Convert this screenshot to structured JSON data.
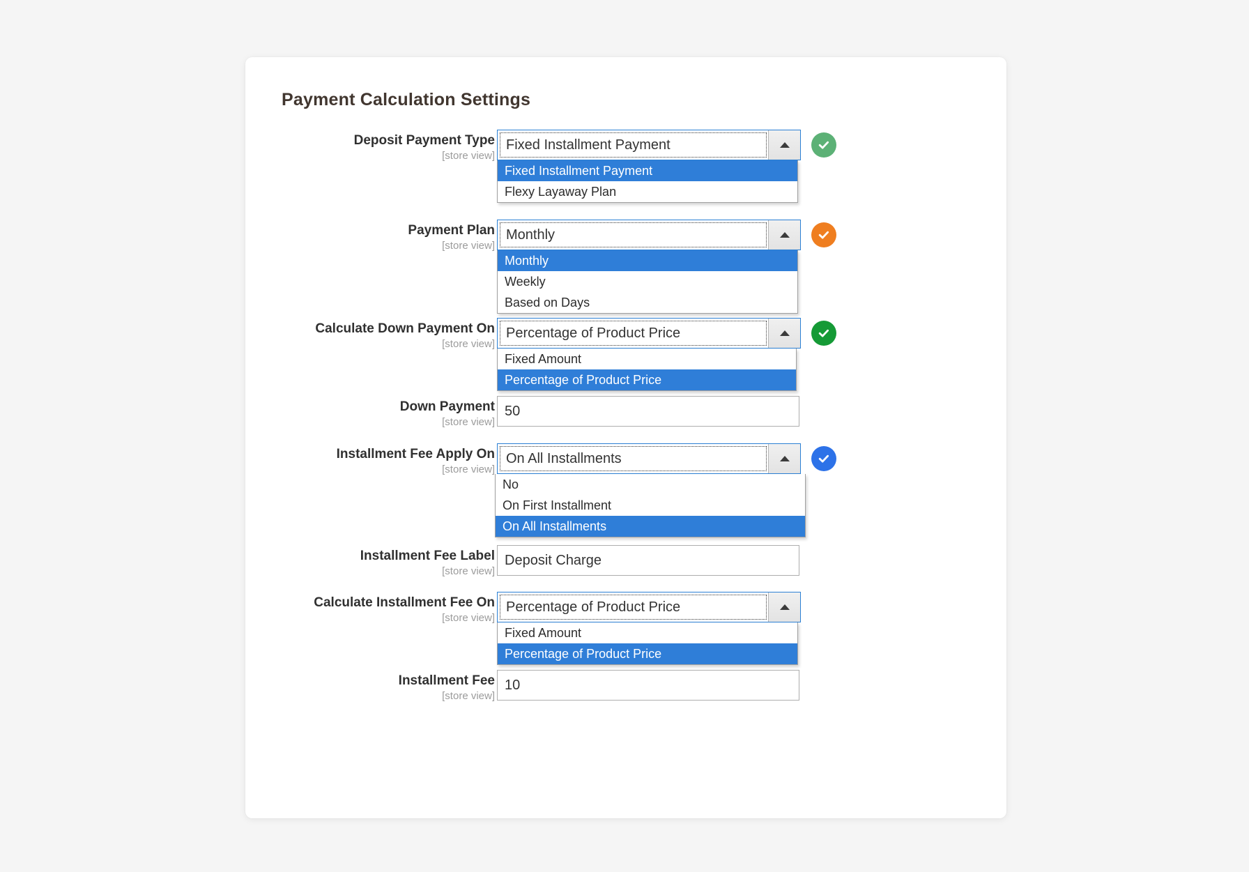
{
  "panel": {
    "title": "Payment Calculation Settings"
  },
  "scope_label": "[store view]",
  "icons": {
    "caret_up": "caret-up-icon",
    "check": "check-icon"
  },
  "colors": {
    "page_bg": "#f5f5f5",
    "panel_bg": "#ffffff",
    "title": "#41362f",
    "label": "#303030",
    "scope": "#9b9b9b",
    "select_border": "#2a7fd4",
    "option_selected_bg": "#2f7ed8",
    "badge_green_light": "#5cb176",
    "badge_green_dark": "#159a36",
    "badge_orange": "#ef7e20",
    "badge_blue": "#2d72e8"
  },
  "fields": [
    {
      "id": "deposit-payment-type",
      "label": "Deposit Payment Type",
      "scope": "[store view]",
      "type": "select",
      "value": "Fixed Installment Payment",
      "options": [
        {
          "label": "Fixed Installment Payment",
          "selected": true
        },
        {
          "label": "Flexy Layaway Plan",
          "selected": false
        }
      ],
      "status": {
        "name": "status-check-green",
        "color": "#5cb176",
        "glyph": "check"
      }
    },
    {
      "id": "payment-plan",
      "label": "Payment Plan",
      "scope": "[store view]",
      "type": "select",
      "value": "Monthly",
      "options": [
        {
          "label": "Monthly",
          "selected": true
        },
        {
          "label": "Weekly",
          "selected": false
        },
        {
          "label": "Based on Days",
          "selected": false
        }
      ],
      "status": {
        "name": "status-check-orange",
        "color": "#ef7e20",
        "glyph": "check"
      }
    },
    {
      "id": "calculate-down-payment-on",
      "label": "Calculate Down Payment On",
      "scope": "[store view]",
      "type": "select",
      "value": "Percentage of Product Price",
      "options": [
        {
          "label": "Fixed Amount",
          "selected": false
        },
        {
          "label": "Percentage of Product Price",
          "selected": true
        }
      ],
      "status": {
        "name": "status-check-green-dark",
        "color": "#159a36",
        "glyph": "check"
      }
    },
    {
      "id": "down-payment",
      "label": "Down Payment",
      "scope": "[store view]",
      "type": "text",
      "value": "50",
      "status": null
    },
    {
      "id": "installment-fee-apply-on",
      "label": "Installment Fee Apply On",
      "scope": "[store view]",
      "type": "select",
      "value": "On All Installments",
      "options": [
        {
          "label": "No",
          "selected": false
        },
        {
          "label": "On First Installment",
          "selected": false
        },
        {
          "label": "On All Installments",
          "selected": true
        }
      ],
      "status": {
        "name": "status-check-blue",
        "color": "#2d72e8",
        "glyph": "check"
      }
    },
    {
      "id": "installment-fee-label",
      "label": "Installment Fee Label",
      "scope": "[store view]",
      "type": "text",
      "value": "Deposit Charge",
      "status": null
    },
    {
      "id": "calculate-installment-fee-on",
      "label": "Calculate Installment Fee On",
      "scope": "[store view]",
      "type": "select",
      "value": "Percentage of Product Price",
      "options": [
        {
          "label": "Fixed Amount",
          "selected": false
        },
        {
          "label": "Percentage of Product Price",
          "selected": true
        }
      ],
      "status": null
    },
    {
      "id": "installment-fee",
      "label": "Installment Fee",
      "scope": "[store view]",
      "type": "text",
      "value": "10",
      "status": null
    }
  ]
}
